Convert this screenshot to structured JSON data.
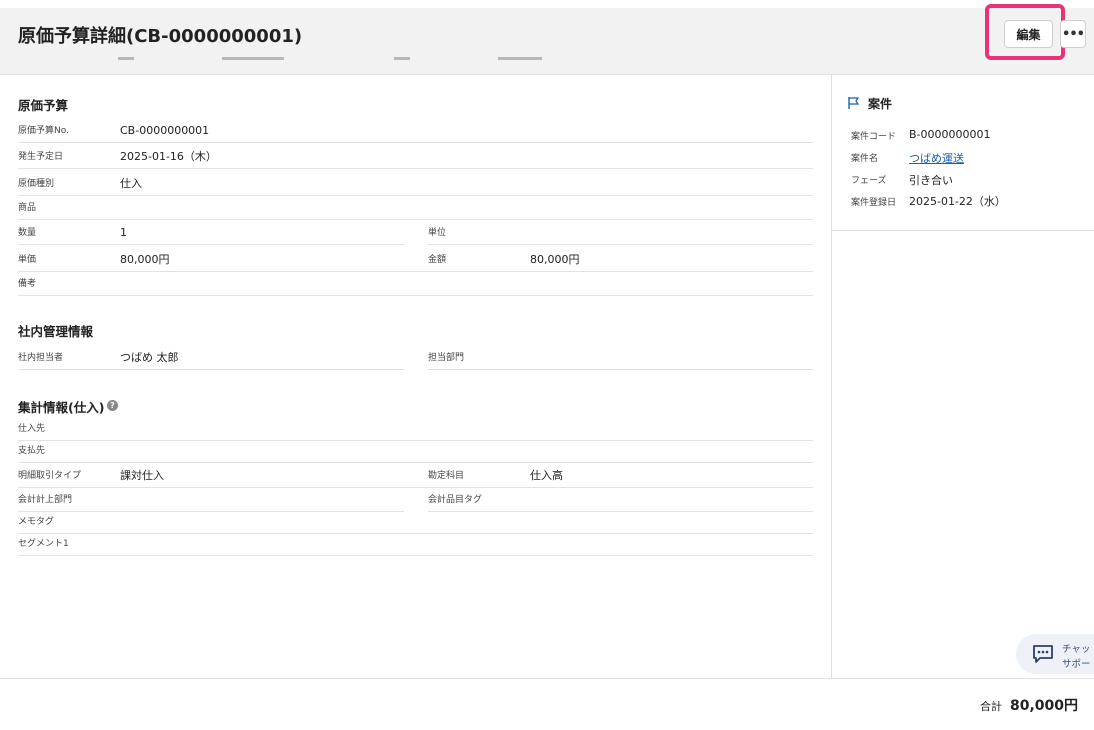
{
  "header": {
    "title": "原価予算詳細(CB-0000000001)",
    "edit_label": "編集",
    "more_label": "•••"
  },
  "cost_budget": {
    "section_title": "原価予算",
    "fields": {
      "no_label": "原価予算No.",
      "no_value": "CB-0000000001",
      "date_label": "発生予定日",
      "date_value": "2025-01-16（木）",
      "type_label": "原価種別",
      "type_value": "仕入",
      "product_label": "商品",
      "product_value": "",
      "qty_label": "数量",
      "qty_value": "1",
      "unit_label": "単位",
      "unit_value": "",
      "price_label": "単価",
      "price_value": "80,000円",
      "amount_label": "金額",
      "amount_value": "80,000円",
      "notes_label": "備考",
      "notes_value": ""
    }
  },
  "internal": {
    "section_title": "社内管理情報",
    "staff_label": "社内担当者",
    "staff_value": "つばめ 太郎",
    "dept_label": "担当部門",
    "dept_value": ""
  },
  "summary": {
    "section_title": "集計情報(仕入)",
    "help_glyph": "?",
    "supplier_label": "仕入先",
    "supplier_value": "",
    "payee_label": "支払先",
    "payee_value": "",
    "tax_type_label": "明細取引タイプ",
    "tax_type_value": "課対仕入",
    "account_label": "勘定科目",
    "account_value": "仕入高",
    "dept_label": "会計計上部門",
    "dept_value": "",
    "item_tag_label": "会計品目タグ",
    "item_tag_value": "",
    "memo_label": "メモタグ",
    "memo_value": "",
    "segment_label": "セグメント1",
    "segment_value": ""
  },
  "project": {
    "title": "案件",
    "code_label": "案件コード",
    "code_value": "B-0000000001",
    "name_label": "案件名",
    "name_value": "つばめ運送",
    "phase_label": "フェーズ",
    "phase_value": "引き合い",
    "reg_label": "案件登録日",
    "reg_value": "2025-01-22（水）"
  },
  "chat": {
    "line1": "チャッ",
    "line2": "サポー"
  },
  "footer": {
    "total_label": "合計",
    "total_value": "80,000円"
  },
  "colors": {
    "accent_highlight": "#e8327a",
    "link": "#1a5fb4"
  },
  "icons": {
    "project": "flag-icon",
    "chat": "chat-bubble-icon",
    "help": "help-icon",
    "more": "more-icon"
  }
}
